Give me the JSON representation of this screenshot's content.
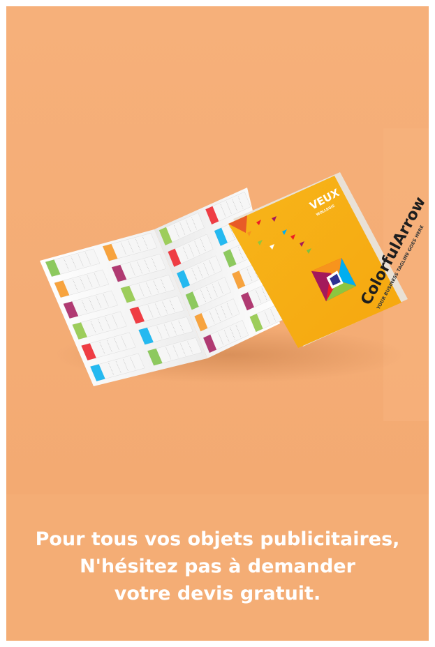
{
  "background_color": "#f4ad75",
  "caption": {
    "line1": "Pour tous vos objets publicitaires,",
    "line2": "N'hésitez pas à demander",
    "line3": "votre devis gratuit."
  },
  "brochure": {
    "brand": "ColorfulArrow",
    "tagline": "YOUR BUSINESS TAGLINE GOES HERE",
    "logo_text": "VEUX",
    "logo_sub": "WOLLEGIS",
    "cover_color": "#f7ac12",
    "accent_colors": [
      "#7ac143",
      "#f7941d",
      "#a3195b",
      "#8dc63f",
      "#ed1c24",
      "#00aeef"
    ]
  }
}
